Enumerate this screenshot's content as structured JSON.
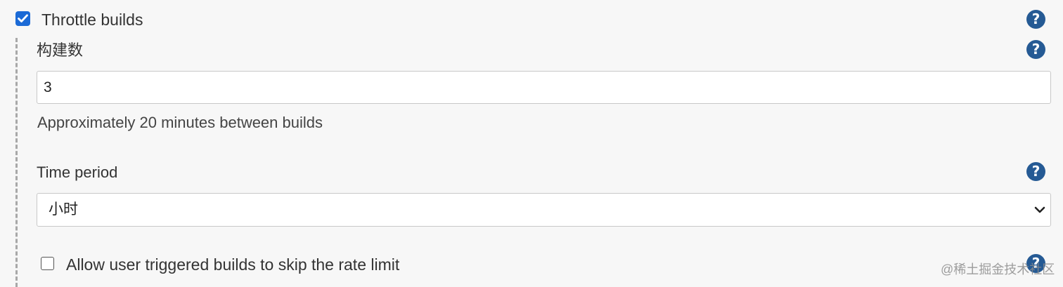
{
  "throttle": {
    "label": "Throttle builds",
    "checked": true
  },
  "build_count": {
    "label": "构建数",
    "value": "3",
    "hint": "Approximately 20 minutes between builds"
  },
  "time_period": {
    "label": "Time period",
    "selected": "小时"
  },
  "skip_rate_limit": {
    "label": "Allow user triggered builds to skip the rate limit",
    "checked": false
  },
  "help_glyph": "?",
  "icons": {
    "help": "help-icon",
    "check": "checkmark-icon",
    "dropdown": "chevron-down-icon"
  },
  "colors": {
    "accent": "#1b6ad6",
    "help": "#255a94",
    "background": "#f7f7f7"
  },
  "watermark": "@稀土掘金技术社区"
}
